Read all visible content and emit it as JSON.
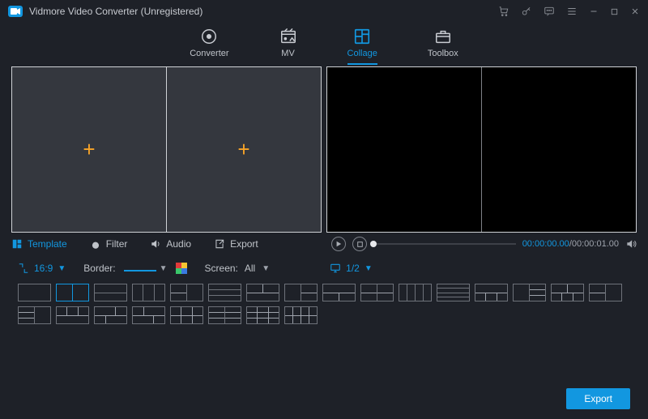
{
  "app": {
    "title": "Vidmore Video Converter (Unregistered)"
  },
  "nav": {
    "converter": "Converter",
    "mv": "MV",
    "collage": "Collage",
    "toolbox": "Toolbox"
  },
  "subtabs": {
    "template": "Template",
    "filter": "Filter",
    "audio": "Audio",
    "export": "Export"
  },
  "player": {
    "current": "00:00:00.00",
    "total": "00:00:01.00"
  },
  "options": {
    "ratio": "16:9",
    "border_label": "Border:",
    "screen_label": "Screen:",
    "screen_value": "All",
    "page": "1/2"
  },
  "footer": {
    "export": "Export"
  },
  "colors": {
    "accent": "#1297e0",
    "plus": "#f7a428"
  }
}
